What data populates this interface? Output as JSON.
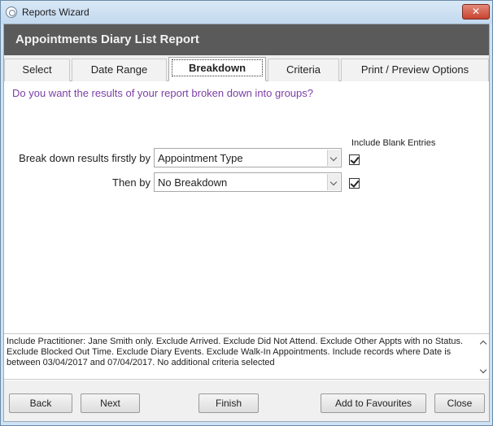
{
  "window": {
    "title": "Reports Wizard",
    "close_glyph": "✕"
  },
  "header": {
    "title": "Appointments Diary List Report"
  },
  "tabs": [
    {
      "label": "Select"
    },
    {
      "label": "Date Range"
    },
    {
      "label": "Breakdown",
      "active": true
    },
    {
      "label": "Criteria"
    },
    {
      "label": "Print / Preview Options"
    }
  ],
  "breakdown": {
    "question": "Do you want the results of your report broken down into groups?",
    "blank_entries_header": "Include Blank Entries",
    "rows": [
      {
        "label": "Break down results firstly by",
        "value": "Appointment Type",
        "include_blank": true
      },
      {
        "label": "Then by",
        "value": "No Breakdown",
        "include_blank": true
      }
    ]
  },
  "summary": {
    "text": "Include Practitioner: Jane Smith only. Exclude Arrived. Exclude Did Not Attend. Exclude Other Appts with no Status. Exclude Blocked Out Time. Exclude Diary Events. Exclude Walk-In Appointments. Include records where Date is between 03/04/2017 and 07/04/2017. No additional criteria selected"
  },
  "footer": {
    "back": "Back",
    "next": "Next",
    "finish": "Finish",
    "add_favourites": "Add to Favourites",
    "close": "Close"
  },
  "colors": {
    "header_bg": "#5a5a5a",
    "question_text": "#7b3fa7",
    "window_frame": "#cfe2f4"
  }
}
